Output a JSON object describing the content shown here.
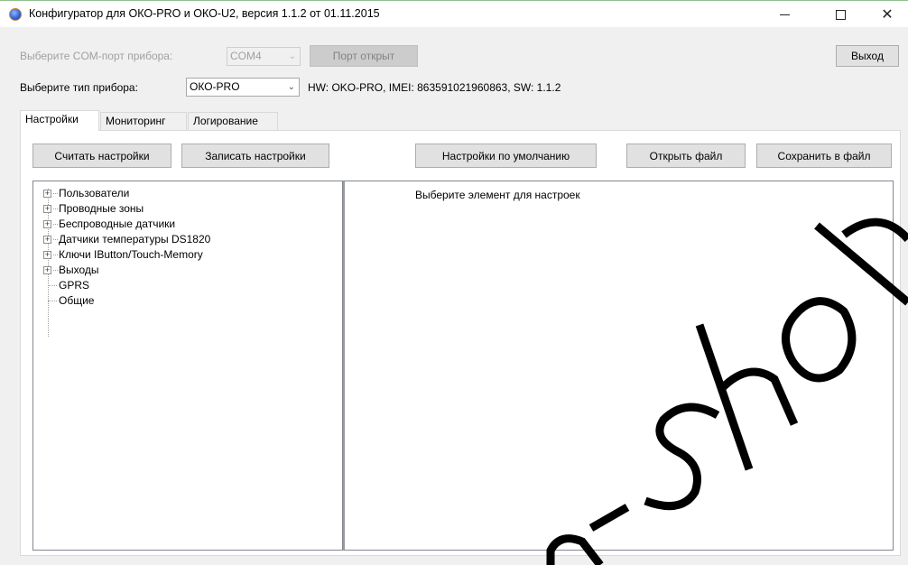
{
  "window": {
    "title": "Конфигуратор для ОКО-PRO и ОКО-U2, версия 1.1.2 от 01.11.2015",
    "close_glyph": "✕"
  },
  "com": {
    "label": "Выберите COM-порт прибора:",
    "selected": "COM4",
    "port_button": "Порт открыт",
    "exit_button": "Выход"
  },
  "device": {
    "label": "Выберите тип прибора:",
    "selected": "ОКО-PRO",
    "info": "HW: OKO-PRO, IMEI: 863591021960863, SW: 1.1.2"
  },
  "tabs": [
    {
      "label": "Настройки",
      "active": true
    },
    {
      "label": "Мониторинг",
      "active": false
    },
    {
      "label": "Логирование",
      "active": false
    }
  ],
  "toolbar": {
    "read": "Считать настройки",
    "write": "Записать настройки",
    "defaults": "Настройки по умолчанию",
    "open_file": "Открыть файл",
    "save_file": "Сохранить в файл"
  },
  "tree": {
    "items": [
      {
        "label": "Пользователи",
        "expandable": true
      },
      {
        "label": "Проводные зоны",
        "expandable": true
      },
      {
        "label": "Беспроводные датчики",
        "expandable": true
      },
      {
        "label": "Датчики температуры DS1820",
        "expandable": true
      },
      {
        "label": "Ключи IButton/Touch-Memory",
        "expandable": true
      },
      {
        "label": "Выходы",
        "expandable": true
      },
      {
        "label": "GPRS",
        "expandable": false
      },
      {
        "label": "Общие",
        "expandable": false
      }
    ],
    "expander_glyph": "+"
  },
  "settings": {
    "hint": "Выберите элемент для настроек"
  },
  "watermark": {
    "color": "#000000"
  }
}
